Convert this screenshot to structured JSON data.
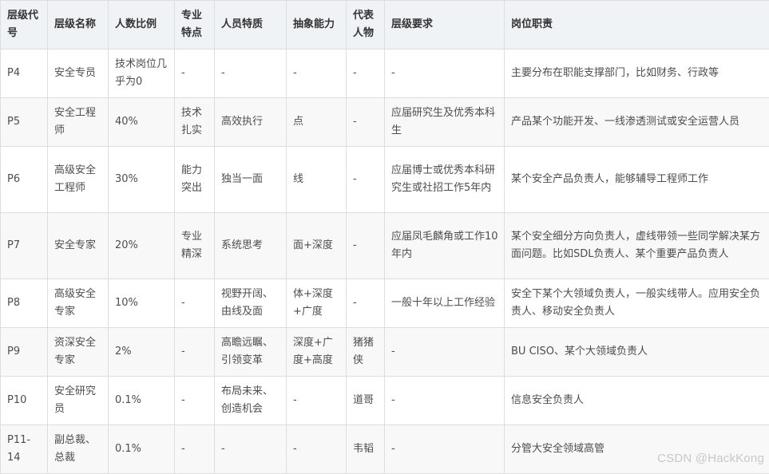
{
  "table": {
    "headers": [
      "层级代号",
      "层级名称",
      "人数比例",
      "专业特点",
      "人员特质",
      "抽象能力",
      "代表人物",
      "层级要求",
      "岗位职责"
    ],
    "rows": [
      [
        "P4",
        "安全专员",
        "技术岗位几乎为0",
        "-",
        "-",
        "-",
        "-",
        "-",
        "主要分布在职能支撑部门，比如财务、行政等"
      ],
      [
        "P5",
        "安全工程师",
        "40%",
        "技术扎实",
        "高效执行",
        "点",
        "-",
        "应届研究生及优秀本科生",
        "产品某个功能开发、一线渗透测试或安全运营人员"
      ],
      [
        "P6",
        "高级安全工程师",
        "30%",
        "能力突出",
        "独当一面",
        "线",
        "-",
        "应届博士或优秀本科研究生或社招工作5年内",
        "某个安全产品负责人，能够辅导工程师工作"
      ],
      [
        "P7",
        "安全专家",
        "20%",
        "专业精深",
        "系统思考",
        "面+深度",
        "-",
        "应届凤毛麟角或工作10年内",
        "某个安全细分方向负责人，虚线带领一些同学解决某方面问题。比如SDL负责人、某个重要产品负责人"
      ],
      [
        "P8",
        "高级安全专家",
        "10%",
        "-",
        "视野开阔、由线及面",
        "体+深度+广度",
        "-",
        "一般十年以上工作经验",
        "安全下某个大领域负责人，一般实线带人。应用安全负责人、移动安全负责人"
      ],
      [
        "P9",
        "资深安全专家",
        "2%",
        "-",
        "高瞻远瞩、引领变革",
        "深度+广度+高度",
        "猪猪侠",
        "-",
        "BU CISO、某个大领域负责人"
      ],
      [
        "P10",
        "安全研究员",
        "0.1%",
        "-",
        "布局未来、创造机会",
        "-",
        "道哥",
        "-",
        "信息安全负责人"
      ],
      [
        "P11-14",
        "副总裁、总裁",
        "0.1%",
        "-",
        "-",
        "-",
        "韦韬",
        "-",
        "分管大安全领域高管"
      ]
    ]
  },
  "watermark": "CSDN @HackKong",
  "colors": {
    "header_bg": "#eff3f5",
    "row_alt_bg": "#f8f8f8",
    "border": "#dddddd",
    "text": "#4d4d4d",
    "watermark": "#c8c8c8"
  }
}
